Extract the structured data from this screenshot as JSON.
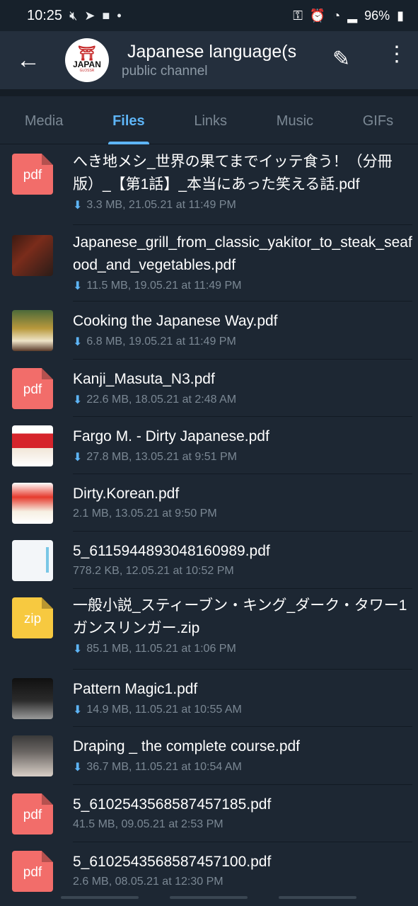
{
  "status_bar": {
    "time": "10:25",
    "battery": "96%"
  },
  "header": {
    "title": "Japanese language(s",
    "subtitle": "public channel",
    "avatar_text": "JAPAN",
    "avatar_subtext": "GLOSSR"
  },
  "tabs": [
    "Media",
    "Files",
    "Links",
    "Music",
    "GIFs"
  ],
  "active_tab": "Files",
  "files": [
    {
      "name": "へき地メシ_世界の果てまでイッテ食う！（分冊版）_【第1話】_本当にあった笑える話.pdf",
      "meta": "3.3 MB, 21.05.21 at 11:49 PM",
      "downloadable": true,
      "icon": "pdf",
      "ext": "pdf"
    },
    {
      "name": "Japanese_grill_from_classic_yakitor_to_steak_seafood_and_vegetables.pdf",
      "meta": "11.5 MB, 19.05.21 at 11:49 PM",
      "downloadable": true,
      "icon": "thumbnail-grill"
    },
    {
      "name": "Cooking the Japanese Way.pdf",
      "meta": "6.8 MB, 19.05.21 at 11:49 PM",
      "downloadable": true,
      "icon": "thumbnail-cooking"
    },
    {
      "name": "Kanji_Masuta_N3.pdf",
      "meta": "22.6 MB, 18.05.21 at 2:48 AM",
      "downloadable": true,
      "icon": "pdf",
      "ext": "pdf"
    },
    {
      "name": "Fargo M. - Dirty Japanese.pdf",
      "meta": "27.8 MB, 13.05.21 at 9:51 PM",
      "downloadable": true,
      "icon": "thumbnail-dirty-japanese"
    },
    {
      "name": "Dirty.Korean.pdf",
      "meta": "2.1 MB, 13.05.21 at 9:50 PM",
      "downloadable": false,
      "icon": "thumbnail-dirty-korean"
    },
    {
      "name": "5_6115944893048160989.pdf",
      "meta": "778.2 KB, 12.05.21 at 10:52 PM",
      "downloadable": false,
      "icon": "thumbnail-white-page"
    },
    {
      "name": "一般小説_スティーブン・キング_ダーク・タワー1　ガンスリンガー.zip",
      "meta": "85.1 MB, 11.05.21 at 1:06 PM",
      "downloadable": true,
      "icon": "zip",
      "ext": "zip"
    },
    {
      "name": "Pattern Magic1.pdf",
      "meta": "14.9 MB, 11.05.21 at 10:55 AM",
      "downloadable": true,
      "icon": "thumbnail-pattern-magic"
    },
    {
      "name": "Draping _ the complete course.pdf",
      "meta": "36.7 MB, 11.05.21 at 10:54 AM",
      "downloadable": true,
      "icon": "thumbnail-draping"
    },
    {
      "name": "5_6102543568587457185.pdf",
      "meta": "41.5 MB, 09.05.21 at 2:53 PM",
      "downloadable": false,
      "icon": "pdf",
      "ext": "pdf"
    },
    {
      "name": "5_6102543568587457100.pdf",
      "meta": "2.6 MB, 08.05.21 at 12:30 PM",
      "downloadable": false,
      "icon": "pdf",
      "ext": "pdf"
    }
  ],
  "colors": {
    "background": "#1d2733",
    "header": "#242f3d",
    "accent": "#5eb5f7",
    "pdf": "#f26d6a",
    "zip": "#f7c940"
  }
}
